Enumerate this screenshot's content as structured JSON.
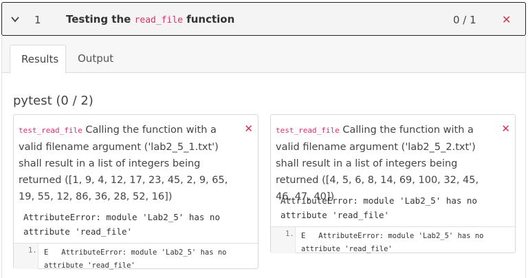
{
  "header": {
    "index": "1",
    "title_before": "Testing the ",
    "title_code": "read_file",
    "title_after": " function",
    "score": "0 / 1",
    "close_glyph": "✕",
    "chevron_icon": "chevron-down-icon"
  },
  "tabs": [
    {
      "label": "Results",
      "active": true
    },
    {
      "label": "Output",
      "active": false
    }
  ],
  "section_title": "pytest (0 / 2)",
  "tests": [
    {
      "name": "test_read_file",
      "description": "Calling the function with a valid filename argument ('lab2_5_1.txt') shall result in a list of integers being returned ([1, 9, 4, 12, 17, 23, 45, 2, 9, 65, 19, 55, 12, 86, 36, 28, 52, 16])",
      "error": "AttributeError: module 'Lab2_5' has no attribute 'read_file'",
      "trace_line_no": "1.",
      "trace_text": "E   AttributeError: module 'Lab2_5' has no attribute 'read_file'",
      "status_glyph": "✕"
    },
    {
      "name": "test_read_file",
      "description": "Calling the function with a valid filename argument ('lab2_5_2.txt') shall result in a list of integers being returned ([4, 5, 6, 8, 14, 69, 100, 32, 45, 46, 47, 40])",
      "error": "AttributeError: module 'Lab2_5' has no attribute 'read_file'",
      "trace_line_no": "1.",
      "trace_text": "E   AttributeError: module 'Lab2_5' has no attribute 'read_file'",
      "status_glyph": "✕"
    }
  ],
  "colors": {
    "accent_code": "#d6336c",
    "fail": "#d9304a"
  }
}
